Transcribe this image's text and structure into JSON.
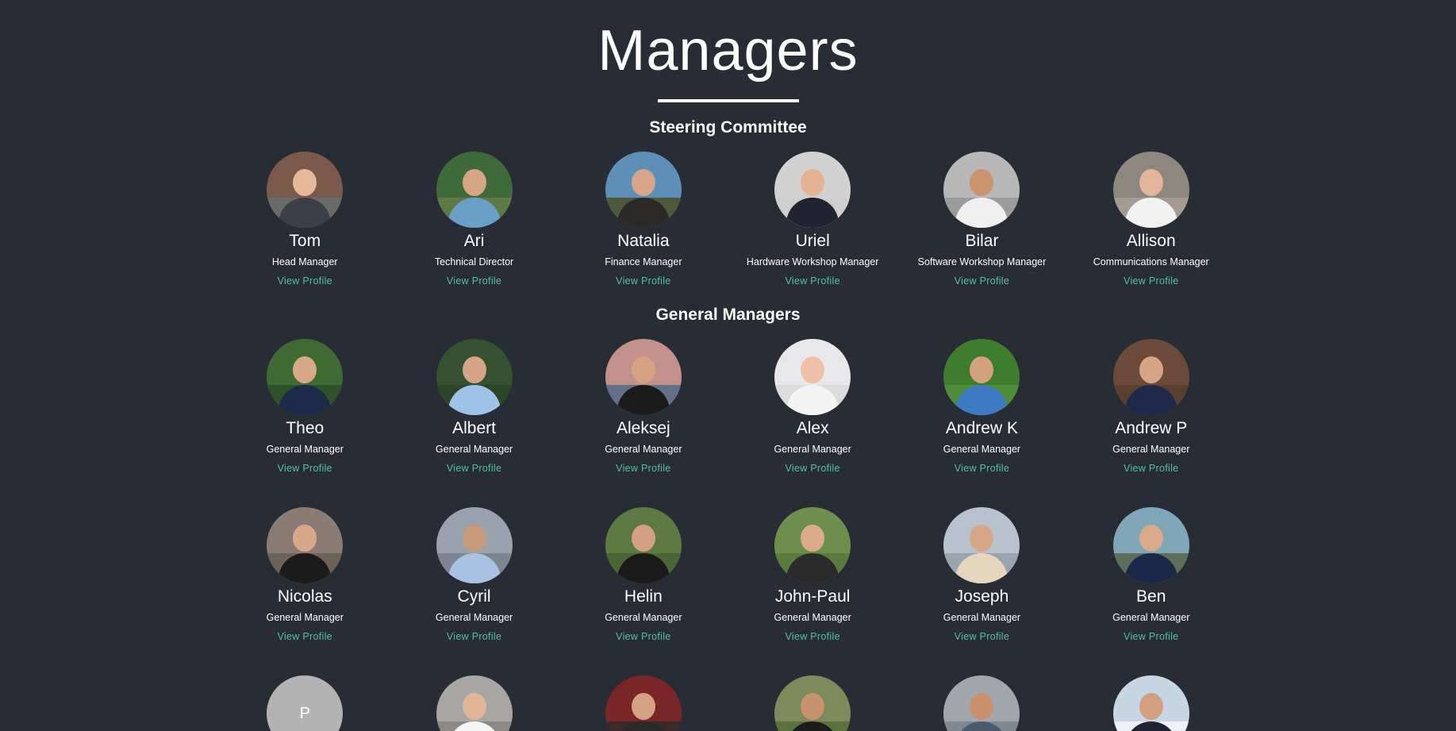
{
  "page": {
    "title": "Managers"
  },
  "sections": {
    "steering": {
      "title": "Steering Committee",
      "members": [
        {
          "name": "Tom",
          "role": "Head Manager",
          "link": "View Profile",
          "bg": "#7a5a4a",
          "skin": "#e8b89a",
          "shirt": "#3a3f4a",
          "ground": "#6a6a6a"
        },
        {
          "name": "Ari",
          "role": "Technical Director",
          "link": "View Profile",
          "bg": "#3f6b3a",
          "skin": "#d7a687",
          "shirt": "#6aa0c8",
          "ground": "#5b7a44"
        },
        {
          "name": "Natalia",
          "role": "Finance Manager",
          "link": "View Profile",
          "bg": "#5e8fb8",
          "skin": "#d9a58a",
          "shirt": "#2c2a28",
          "ground": "#4d5a3a"
        },
        {
          "name": "Uriel",
          "role": "Hardware Workshop Manager",
          "link": "View Profile",
          "bg": "#d2d2d2",
          "skin": "#e5b394",
          "shirt": "#1f2430",
          "ground": "#cfcfcf"
        },
        {
          "name": "Bilar",
          "role": "Software Workshop Manager",
          "link": "View Profile",
          "bg": "#b8b8b8",
          "skin": "#c9946e",
          "shirt": "#f0f0f0",
          "ground": "#9c9c9c"
        },
        {
          "name": "Allison",
          "role": "Communications Manager",
          "link": "View Profile",
          "bg": "#8d8780",
          "skin": "#e3b59a",
          "shirt": "#f2f2f2",
          "ground": "#a49c94"
        }
      ]
    },
    "general": {
      "title": "General Managers",
      "rows": [
        [
          {
            "name": "Theo",
            "role": "General Manager",
            "link": "View Profile",
            "bg": "#3f6a33",
            "skin": "#d9a88b",
            "shirt": "#1d2b4a",
            "ground": "#2f5328"
          },
          {
            "name": "Albert",
            "role": "General Manager",
            "link": "View Profile",
            "bg": "#34522f",
            "skin": "#d7a487",
            "shirt": "#9fc2e8",
            "ground": "#2c4527"
          },
          {
            "name": "Aleksej",
            "role": "General Manager",
            "link": "View Profile",
            "bg": "#c4908a",
            "skin": "#d7a283",
            "shirt": "#1b1b1b",
            "ground": "#62708a"
          },
          {
            "name": "Alex",
            "role": "General Manager",
            "link": "View Profile",
            "bg": "#e8e8ea",
            "skin": "#efc2a7",
            "shirt": "#f4f4f4",
            "ground": "#dcdcde"
          },
          {
            "name": "Andrew K",
            "role": "General Manager",
            "link": "View Profile",
            "bg": "#3e7d2e",
            "skin": "#d4a07e",
            "shirt": "#3f7ac4",
            "ground": "#4f8e38"
          },
          {
            "name": "Andrew P",
            "role": "General Manager",
            "link": "View Profile",
            "bg": "#6b4a3a",
            "skin": "#d7a487",
            "shirt": "#1f2a4a",
            "ground": "#5a3e30"
          }
        ],
        [
          {
            "name": "Nicolas",
            "role": "General Manager",
            "link": "View Profile",
            "bg": "#8a7c72",
            "skin": "#d9a88a",
            "shirt": "#1b1b1b",
            "ground": "#6c625a"
          },
          {
            "name": "Cyril",
            "role": "General Manager",
            "link": "View Profile",
            "bg": "#9aa3ad",
            "skin": "#c99a78",
            "shirt": "#aac2e2",
            "ground": "#7d868f"
          },
          {
            "name": "Helin",
            "role": "General Manager",
            "link": "View Profile",
            "bg": "#5d7a43",
            "skin": "#d4a083",
            "shirt": "#1a1a1a",
            "ground": "#4a6634"
          },
          {
            "name": "John-Paul",
            "role": "General Manager",
            "link": "View Profile",
            "bg": "#6d8f4e",
            "skin": "#dcab8d",
            "shirt": "#2b2b2b",
            "ground": "#5b7a3d"
          },
          {
            "name": "Joseph",
            "role": "General Manager",
            "link": "View Profile",
            "bg": "#b7c2cc",
            "skin": "#d6a687",
            "shirt": "#e6d6bd",
            "ground": "#9aa4ae"
          },
          {
            "name": "Ben",
            "role": "General Manager",
            "link": "View Profile",
            "bg": "#7fa7b8",
            "skin": "#d9a98a",
            "shirt": "#1c2848",
            "ground": "#5d6f5a"
          }
        ],
        [
          {
            "name": "",
            "role": "",
            "link": "",
            "initial": "P"
          },
          {
            "name": "",
            "role": "",
            "link": "",
            "bg": "#a8a6a3",
            "skin": "#e1b697",
            "shirt": "#f5f5f5",
            "ground": "#8d8a86"
          },
          {
            "name": "",
            "role": "",
            "link": "",
            "bg": "#7a2626",
            "skin": "#d6a182",
            "shirt": "#2a2a2a",
            "ground": "#3a2a2a"
          },
          {
            "name": "",
            "role": "",
            "link": "",
            "bg": "#7c8a5c",
            "skin": "#c8926f",
            "shirt": "#1c1c1c",
            "ground": "#5d7040"
          },
          {
            "name": "",
            "role": "",
            "link": "",
            "bg": "#a0a6ac",
            "skin": "#c9926d",
            "shirt": "#4b5a6e",
            "ground": "#7f8790"
          },
          {
            "name": "",
            "role": "",
            "link": "",
            "bg": "#c7d6e4",
            "skin": "#d2a07f",
            "shirt": "#1f2430",
            "ground": "#eef2f6"
          }
        ]
      ]
    }
  }
}
